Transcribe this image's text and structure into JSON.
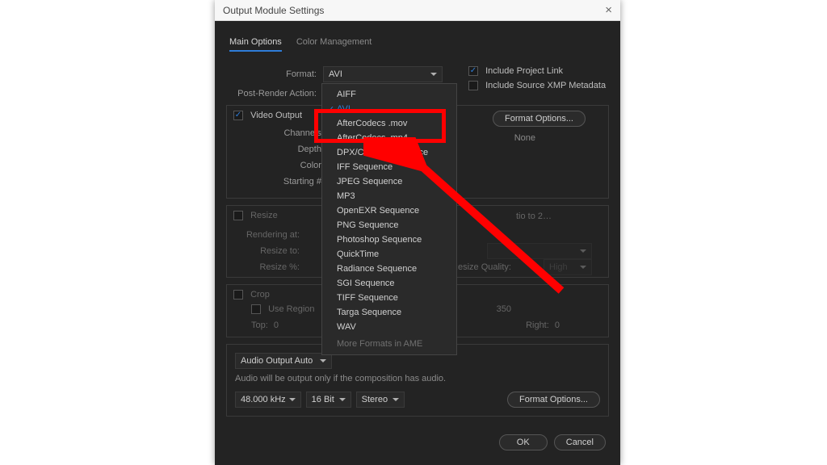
{
  "titlebar": {
    "title": "Output Module Settings"
  },
  "tabs": {
    "main": "Main Options",
    "color": "Color Management"
  },
  "format": {
    "label": "Format:",
    "value": "AVI",
    "include_link": "Include Project Link",
    "include_xmp": "Include Source XMP Metadata"
  },
  "post_render": {
    "label": "Post-Render Action:"
  },
  "video": {
    "title": "Video Output",
    "channels": "Channels:",
    "depth": "Depth:",
    "color": "Color:",
    "starting": "Starting #:",
    "format_options": "Format Options...",
    "none": "None"
  },
  "resize": {
    "title": "Resize",
    "rendering": "Rendering at:",
    "resize_to": "Resize to:",
    "resize_pct": "Resize %:",
    "ratio_hint": "tio to 2…",
    "quality_lbl": "Resize Quality:",
    "quality_val": "High"
  },
  "crop": {
    "title": "Crop",
    "use_region": "Use Region",
    "size_hint": "350",
    "top": "Top:",
    "top_v": "0",
    "right": "Right:",
    "right_v": "0"
  },
  "audio": {
    "mode": "Audio Output Auto",
    "note": "Audio will be output only if the composition has audio.",
    "rate": "48.000 kHz",
    "bit": "16 Bit",
    "chan": "Stereo",
    "format_options": "Format Options..."
  },
  "buttons": {
    "ok": "OK",
    "cancel": "Cancel"
  },
  "dropdown": {
    "items": [
      "AIFF",
      "AVI",
      "AfterCodecs .mov",
      "AfterCodecs .mp4",
      "DPX/Cineon Sequence",
      "IFF Sequence",
      "JPEG Sequence",
      "MP3",
      "OpenEXR Sequence",
      "PNG Sequence",
      "Photoshop Sequence",
      "QuickTime",
      "Radiance Sequence",
      "SGI Sequence",
      "TIFF Sequence",
      "Targa Sequence",
      "WAV"
    ],
    "more": "More Formats in AME"
  }
}
